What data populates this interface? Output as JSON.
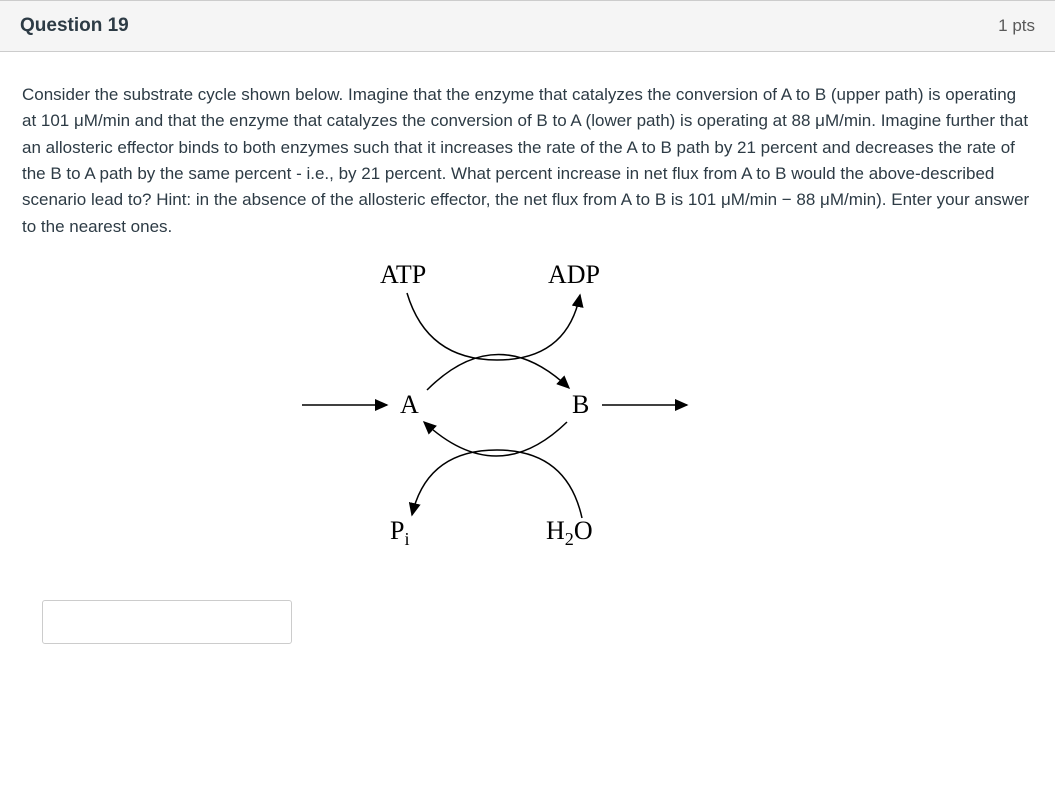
{
  "header": {
    "title": "Question 19",
    "points": "1 pts"
  },
  "question": {
    "text": "Consider the substrate cycle shown below. Imagine that the enzyme that catalyzes the conversion of A to B (upper path) is operating at 101 μM/min and that the enzyme that catalyzes the conversion of B to A (lower path) is operating at 88 μM/min. Imagine further that an allosteric effector binds to both enzymes such that it increases the rate of the A to B path by 21  percent and decreases the rate of the B to A path by the same percent - i.e., by 21 percent. What percent increase in net flux from A to B would the above-described scenario lead to? Hint: in the absence of the allosteric effector, the net flux from A to B is 101 μM/min − 88 μM/min). Enter your answer to the nearest ones."
  },
  "diagram": {
    "atp": "ATP",
    "adp": "ADP",
    "a": "A",
    "b": "B",
    "pi_base": "P",
    "pi_sub": "i",
    "h2o_h": "H",
    "h2o_sub": "2",
    "h2o_o": "O"
  },
  "answer": {
    "value": ""
  }
}
